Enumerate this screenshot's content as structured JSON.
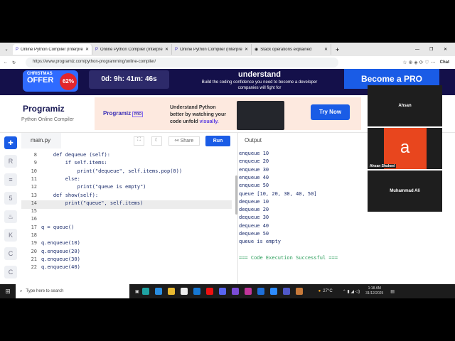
{
  "tabs": [
    {
      "label": "Online Python Compiler (Interpreter)"
    },
    {
      "label": "Online Python Compiler (Interpreter)"
    },
    {
      "label": "Online Python Compiler (Interpreter)"
    },
    {
      "label": "Stack operations explained"
    }
  ],
  "address": {
    "url": "https://www.programiz.com/python-programming/online-compiler/",
    "chat": "Chat"
  },
  "promo": {
    "christmas": "CHRISTMAS",
    "offer": "OFFER",
    "discount": "62%",
    "timer": "0d: 9h: 41m: 46s",
    "headline": "understand",
    "sub1": "Build the coding confidence you need to become a developer",
    "sub2": "companies will fight for",
    "cta": "Become a PRO"
  },
  "brand": {
    "logo": "Programiz",
    "subtitle": "Python Online Compiler"
  },
  "ad": {
    "logo": "Programiz",
    "pro": "PRO",
    "line1": "Understand Python",
    "line2": "better by watching your",
    "line3a": "code unfold ",
    "line3b": "visually.",
    "cta": "Try Now"
  },
  "editor": {
    "filename": "main.py",
    "share": "Share",
    "run": "Run",
    "output_label": "Output",
    "lines": [
      {
        "n": "8",
        "code": "    def dequeue (self):"
      },
      {
        "n": "9",
        "code": "        if self.items:"
      },
      {
        "n": "10",
        "code": "            print(\"dequeue\", self.items.pop(0))"
      },
      {
        "n": "11",
        "code": "        else:"
      },
      {
        "n": "12",
        "code": "            print(\"queue is empty\")"
      },
      {
        "n": "13",
        "code": "    def show(self):"
      },
      {
        "n": "14",
        "code": "        print(\"queue\", self.items)"
      },
      {
        "n": "15",
        "code": ""
      },
      {
        "n": "16",
        "code": ""
      },
      {
        "n": "17",
        "code": "q = queue()"
      },
      {
        "n": "18",
        "code": ""
      },
      {
        "n": "19",
        "code": "q.enqueue(10)"
      },
      {
        "n": "20",
        "code": "q.enqueue(20)"
      },
      {
        "n": "21",
        "code": "q.enqueue(30)"
      },
      {
        "n": "22",
        "code": "q.enqueue(40)"
      }
    ],
    "output": [
      "enqueue 10",
      "enqueue 20",
      "enqueue 30",
      "enqueue 40",
      "enqueue 50",
      "queue [10, 20, 30, 40, 50]",
      "dequeue 10",
      "dequeue 20",
      "dequeue 30",
      "dequeue 40",
      "dequeue 50",
      "queue is empty",
      "",
      "=== Code Execution Successful ==="
    ]
  },
  "video": {
    "p1": "Ahsan",
    "p2": "Ahsan Shakeel",
    "p2_initial": "a",
    "p3": "Muhammad Ali"
  },
  "taskbar": {
    "search": "Type here to search",
    "weather": "27°C",
    "time": "1:18 AM",
    "date": "31/12/2025"
  }
}
